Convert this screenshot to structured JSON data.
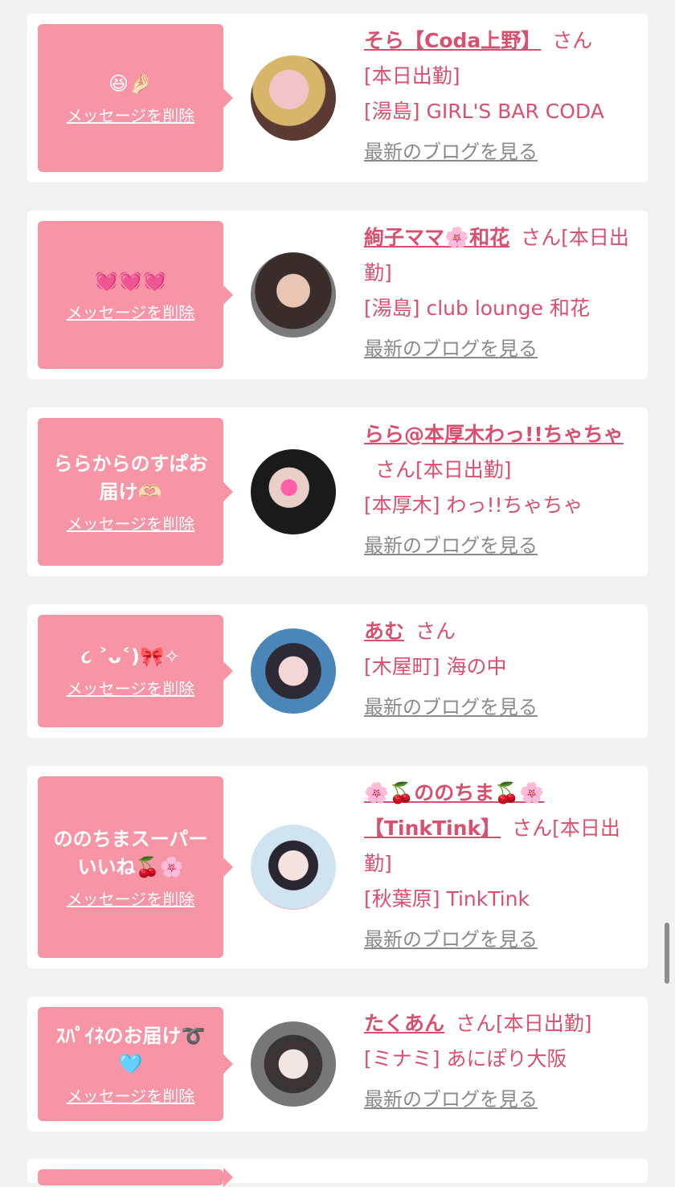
{
  "common": {
    "delete_label": "メッセージを削除",
    "blog_label": "最新のブログを見る",
    "san": "さん"
  },
  "items": [
    {
      "message": "😆🤌🏻",
      "name": "そら【Coda上野】",
      "status": "[本日出勤]",
      "area": "[湯島]",
      "shop": "GIRL'S BAR CODA"
    },
    {
      "message": "💓💓💓",
      "name": "絢子ママ🌸和花",
      "status": "[本日出勤]",
      "area": "[湯島]",
      "shop": "club lounge 和花"
    },
    {
      "message": "ららからのすぱお届け🫶🏻",
      "name": "らら@本厚木わっ!!ちゃちゃ",
      "status": "[本日出勤]",
      "area": "[本厚木]",
      "shop": "わっ!!ちゃちゃ"
    },
    {
      "message": "૮ ˃ᴗ˂)🎀✧",
      "name": "あむ",
      "status": "",
      "area": "[木屋町]",
      "shop": "海の中"
    },
    {
      "message": "ののちまスーパーいいね🍒🌸",
      "name": "🌸🍒ののちま🍒🌸【TinkTink】",
      "status": "[本日出勤]",
      "area": "[秋葉原]",
      "shop": "TinkTink"
    },
    {
      "message": "ｽﾊﾟｲﾈのお届け➰🩵",
      "name": "たくあん",
      "status": "[本日出勤]",
      "area": "[ミナミ]",
      "shop": "あにぽり大阪"
    }
  ],
  "colors": {
    "bubble": "#f794a6",
    "accent": "#d9506e",
    "background": "#f2f2f2",
    "link_gray": "#8a8a8a"
  }
}
